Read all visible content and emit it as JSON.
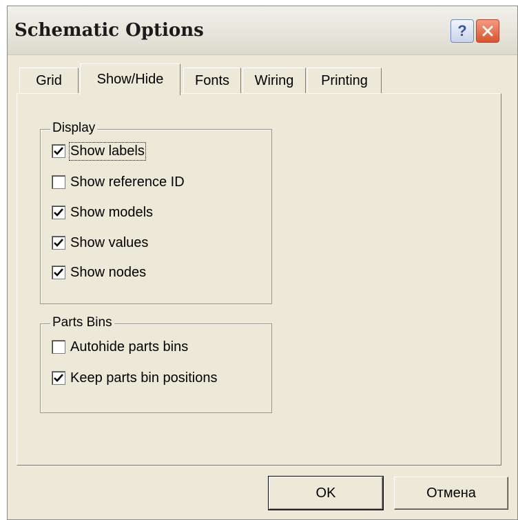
{
  "window": {
    "title": "Schematic Options",
    "help_label": "?"
  },
  "tabs": [
    {
      "label": "Grid"
    },
    {
      "label": "Show/Hide",
      "active": true
    },
    {
      "label": "Fonts"
    },
    {
      "label": "Wiring"
    },
    {
      "label": "Printing"
    }
  ],
  "display_group": {
    "legend": "Display",
    "items": [
      {
        "label": "Show labels",
        "checked": true
      },
      {
        "label": "Show reference ID",
        "checked": false
      },
      {
        "label": "Show models",
        "checked": true
      },
      {
        "label": "Show values",
        "checked": true
      },
      {
        "label": "Show nodes",
        "checked": true
      }
    ]
  },
  "parts_group": {
    "legend": "Parts Bins",
    "items": [
      {
        "label": "Autohide parts bins",
        "checked": false
      },
      {
        "label": "Keep parts bin positions",
        "checked": true
      }
    ]
  },
  "buttons": {
    "ok": "OK",
    "cancel": "Отмена"
  }
}
